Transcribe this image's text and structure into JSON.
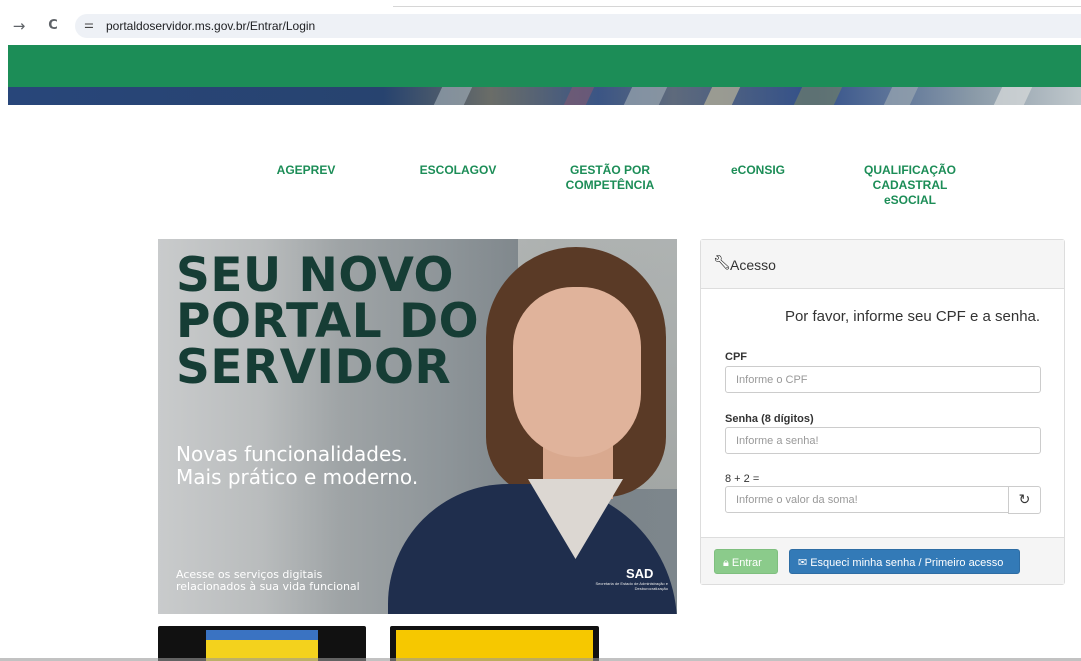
{
  "browser": {
    "back_glyph": "→",
    "reload_glyph": "C",
    "site_info_glyph": "⚌",
    "url": "portaldoservidor.ms.gov.br/Entrar/Login"
  },
  "menu": {
    "ageprev": "AGEPREV",
    "escolagov": "ESCOLAGOV",
    "gestao_line1": "GESTÃO POR",
    "gestao_line2": "COMPETÊNCIA",
    "econsig": "eCONSIG",
    "qualif_line1": "QUALIFICAÇÃO",
    "qualif_line2": "CADASTRAL",
    "qualif_line3": "eSOCIAL"
  },
  "hero": {
    "headline_1": "SEU NOVO",
    "headline_2": "PORTAL DO",
    "headline_3": "SERVIDOR",
    "sub_1": "Novas funcionalidades.",
    "sub_2": "Mais prático e moderno.",
    "foot_1": "Acesse os serviços digitais",
    "foot_2": "relacionados à sua vida funcional",
    "logo": "SAD",
    "logo_sub": "Secretaria de Estado de Administração e Desburocratização"
  },
  "login": {
    "title": "Acesso",
    "prompt": "Por favor, informe seu CPF e a senha.",
    "cpf_label": "CPF",
    "cpf_placeholder": "Informe o CPF",
    "senha_label": "Senha (8 dígitos)",
    "senha_placeholder": "Informe a senha!",
    "captcha_label": "8 + 2 =",
    "captcha_placeholder": "Informe o valor da soma!",
    "enter_label": "Entrar",
    "forgot_label": "Esqueci minha senha / Primeiro acesso"
  },
  "colors": {
    "brand_green": "#1c8d57",
    "primary_blue": "#337ab7",
    "success_green": "#8bcb8b"
  }
}
